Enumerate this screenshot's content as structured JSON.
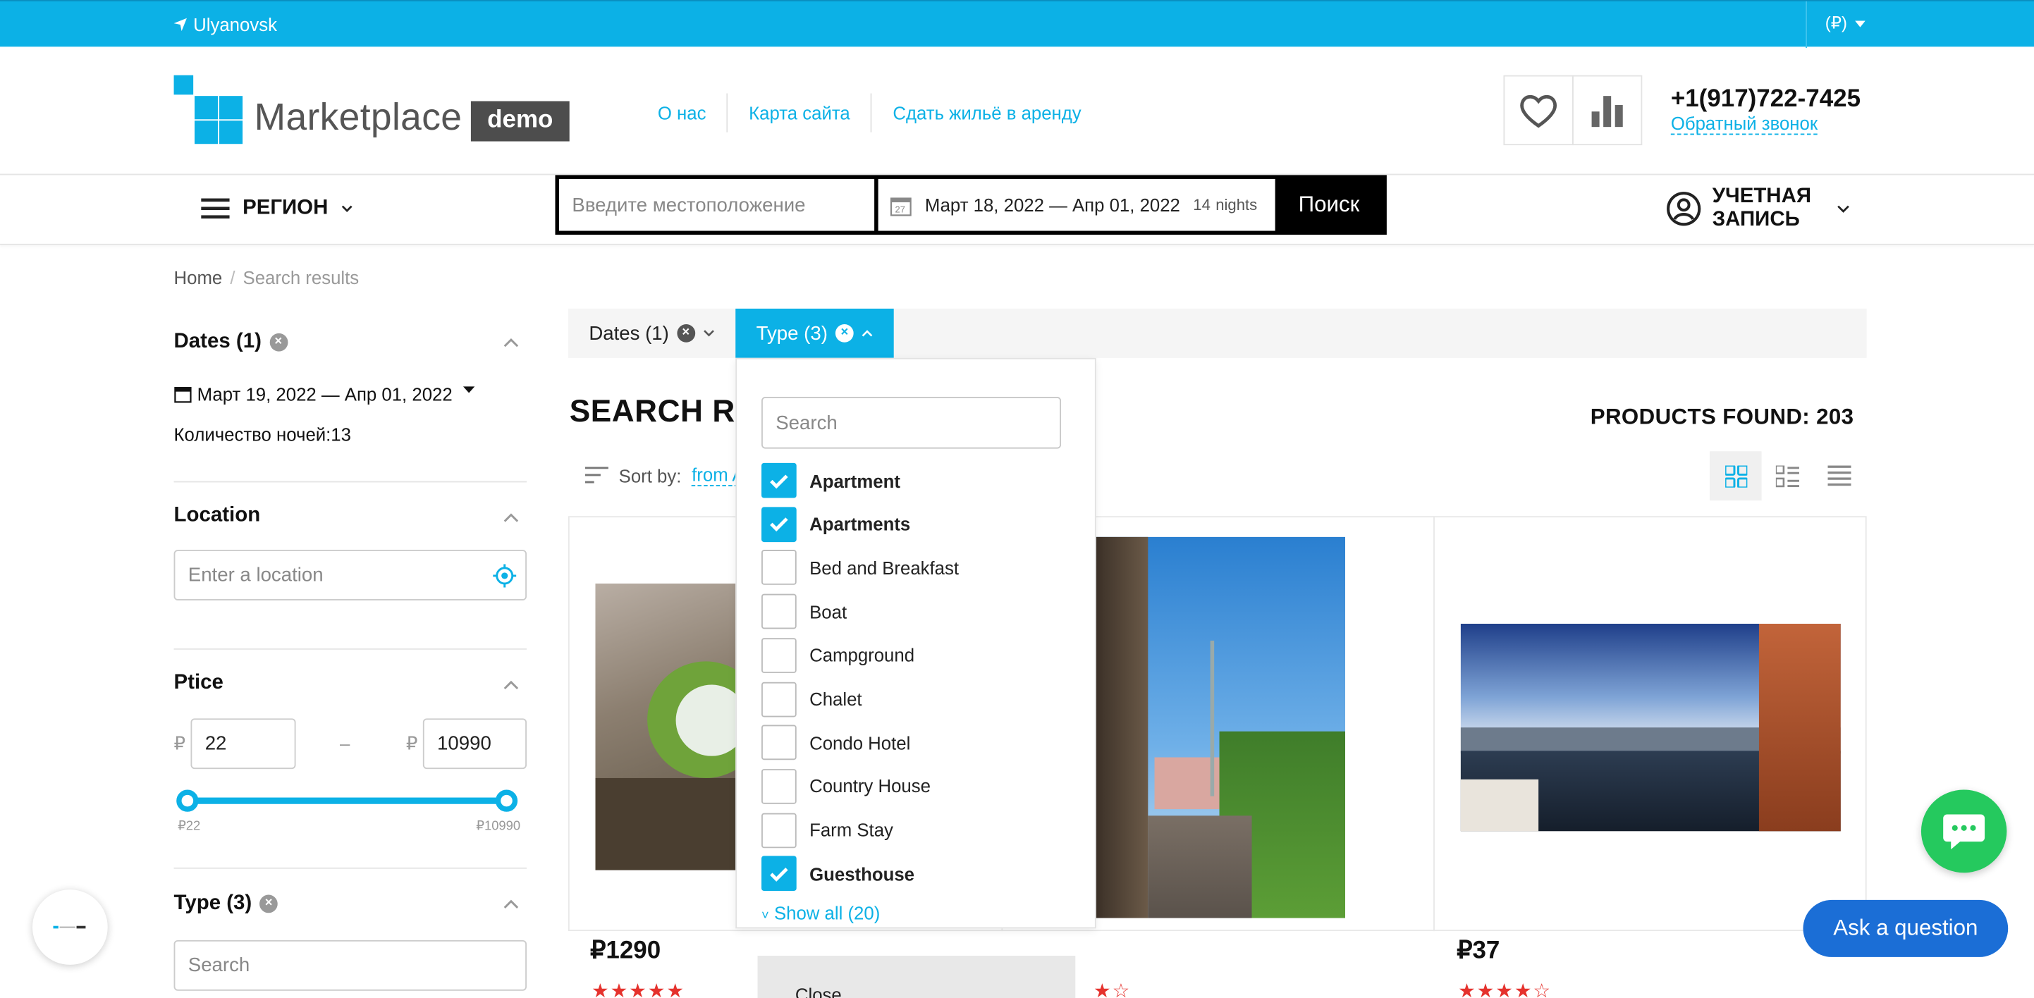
{
  "topbar": {
    "city": "Ulyanovsk",
    "currency": "(₽)"
  },
  "header": {
    "logo_text": "Marketplace",
    "logo_badge": "demo",
    "nav": [
      "О нас",
      "Карта сайта",
      "Сдать жильё в аренду"
    ],
    "phone": "+1(917)722-7425",
    "callback": "Обратный звонок"
  },
  "navrow": {
    "region": "РЕГИОН",
    "search_placeholder": "Введите местоположение",
    "dates": "Март 18, 2022 — Апр 01, 2022",
    "nights_count": "14",
    "nights_label": "nights",
    "search_button": "Поиск",
    "account_line1": "УЧЕТНАЯ",
    "account_line2": "ЗАПИСЬ"
  },
  "breadcrumb": {
    "home": "Home",
    "current": "Search results"
  },
  "sidebar": {
    "dates_title": "Dates (1)",
    "dates_value": "Март 19, 2022 — Апр 01, 2022",
    "nights": "Количество ночей:13",
    "location_title": "Location",
    "location_placeholder": "Enter a location",
    "price_title": "Ptice",
    "currency": "₽",
    "price_min": "22",
    "price_max": "10990",
    "price_dash": "–",
    "slider_min_label": "₽22",
    "slider_max_label": "₽10990",
    "type_title": "Type (3)",
    "type_search_placeholder": "Search"
  },
  "filters": {
    "dates_tab": "Dates (1)",
    "type_tab": "Type (3)"
  },
  "results": {
    "title": "SEARCH RE",
    "found": "PRODUCTS FOUND: 203",
    "sort_label": "Sort by:",
    "sort_value": "from A",
    "cards": [
      {
        "price": "₽1290",
        "stars": "★★★★★"
      },
      {
        "price": "",
        "stars": "★☆"
      },
      {
        "price": "₽37",
        "stars": "★★★★☆"
      }
    ]
  },
  "type_dropdown": {
    "search_placeholder": "Search",
    "options": [
      {
        "label": "Apartment",
        "checked": true
      },
      {
        "label": "Apartments",
        "checked": true
      },
      {
        "label": "Bed and Breakfast",
        "checked": false
      },
      {
        "label": "Boat",
        "checked": false
      },
      {
        "label": "Campground",
        "checked": false
      },
      {
        "label": "Chalet",
        "checked": false
      },
      {
        "label": "Condo Hotel",
        "checked": false
      },
      {
        "label": "Country House",
        "checked": false
      },
      {
        "label": "Farm Stay",
        "checked": false
      },
      {
        "label": "Guesthouse",
        "checked": true
      }
    ],
    "show_all": "Show all (20)",
    "close": "Close"
  },
  "floating": {
    "ask": "Ask a question"
  },
  "colors": {
    "accent": "#0cb1e6",
    "chat": "#25c95e",
    "ask": "#1b6ed6",
    "stars": "#e5322d"
  }
}
